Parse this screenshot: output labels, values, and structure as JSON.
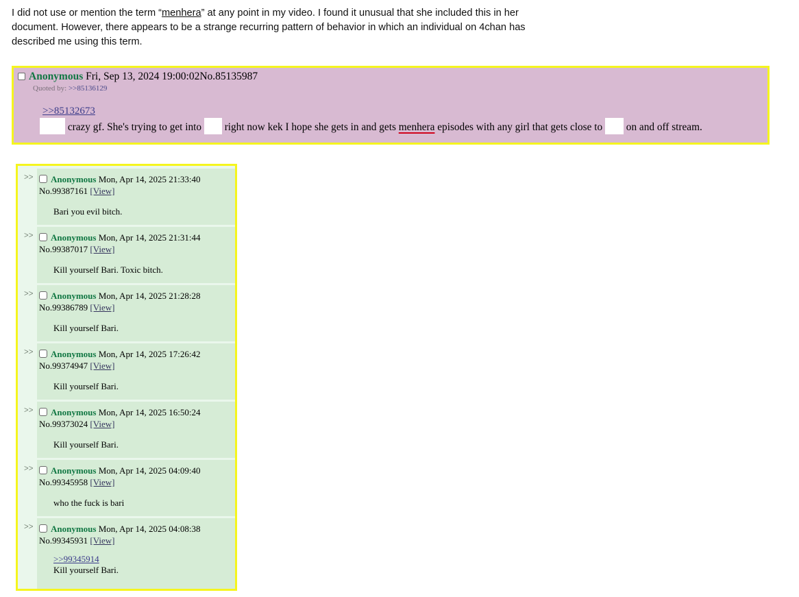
{
  "intro": {
    "part1": "I did not use or mention the term “",
    "term": "menhera",
    "part2": "” at any point in my video. I found it unusual that she included this in her document. However, there appears to be a strange recurring pattern of behavior in which an individual on 4chan has described me using this term."
  },
  "first_post": {
    "name": "Anonymous",
    "datetime": "Fri, Sep 13, 2024 19:00:02",
    "number": "No.85135987",
    "quoted_by_label": "Quoted by:",
    "quoted_by_ref": ">>85136129",
    "quote_ref": ">>85132673",
    "text1": "crazy gf. She's trying to get into",
    "text2": "right now kek I hope she gets in and gets",
    "term": "menhera",
    "text3": "episodes with any girl that gets close to",
    "text4": "on and off stream."
  },
  "replies": [
    {
      "arrows": ">>",
      "name": "Anonymous",
      "datetime": "Mon, Apr 14, 2025 21:33:40",
      "number": "No.99387161",
      "view": "[View]",
      "message": "Bari you evil bitch."
    },
    {
      "arrows": ">>",
      "name": "Anonymous",
      "datetime": "Mon, Apr 14, 2025 21:31:44",
      "number": "No.99387017",
      "view": "[View]",
      "message": "Kill yourself Bari. Toxic bitch."
    },
    {
      "arrows": ">>",
      "name": "Anonymous",
      "datetime": "Mon, Apr 14, 2025 21:28:28",
      "number": "No.99386789",
      "view": "[View]",
      "message": "Kill yourself Bari."
    },
    {
      "arrows": ">>",
      "name": "Anonymous",
      "datetime": "Mon, Apr 14, 2025 17:26:42",
      "number": "No.99374947",
      "view": "[View]",
      "message": "Kill yourself Bari."
    },
    {
      "arrows": ">>",
      "name": "Anonymous",
      "datetime": "Mon, Apr 14, 2025 16:50:24",
      "number": "No.99373024",
      "view": "[View]",
      "message": "Kill yourself Bari."
    },
    {
      "arrows": ">>",
      "name": "Anonymous",
      "datetime": "Mon, Apr 14, 2025 04:09:40",
      "number": "No.99345958",
      "view": "[View]",
      "message": "who the fuck is bari"
    },
    {
      "arrows": ">>",
      "name": "Anonymous",
      "datetime": "Mon, Apr 14, 2025 04:08:38",
      "number": "No.99345931",
      "view": "[View]",
      "quote_ref": ">>99345914",
      "message": "Kill yourself Bari."
    }
  ]
}
